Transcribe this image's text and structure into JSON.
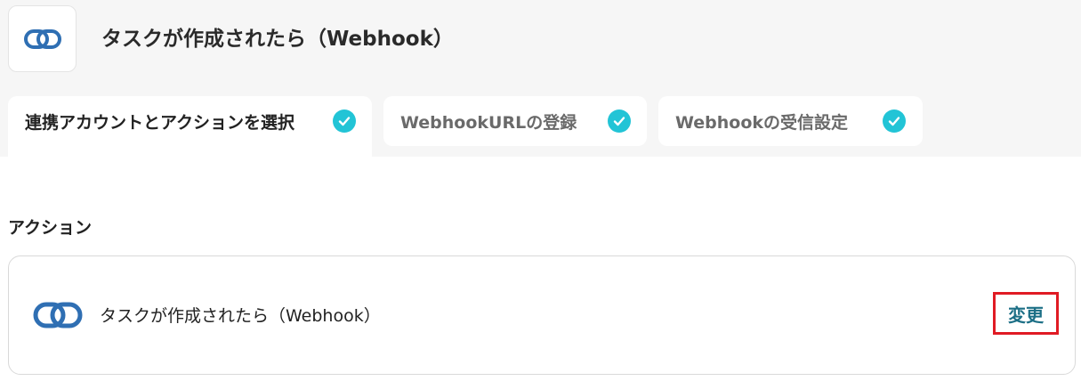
{
  "header": {
    "title": "タスクが作成されたら（Webhook）",
    "logo_icon": "link-rings-icon"
  },
  "tabs": [
    {
      "label": "連携アカウントとアクションを選択",
      "status_icon": "check-circle-icon",
      "active": true
    },
    {
      "label": "WebhookURLの登録",
      "status_icon": "check-circle-icon",
      "active": false
    },
    {
      "label": "Webhookの受信設定",
      "status_icon": "check-circle-icon",
      "active": false
    }
  ],
  "action_section": {
    "heading": "アクション",
    "card": {
      "icon": "link-rings-icon",
      "text": "タスクが作成されたら（Webhook）",
      "change_label": "変更"
    }
  },
  "colors": {
    "brand_blue": "#2f6fb3",
    "check_teal": "#22c4d6",
    "change_text": "#1c6f86",
    "highlight_red": "#e01b24",
    "header_background": "#f6f6f6"
  }
}
